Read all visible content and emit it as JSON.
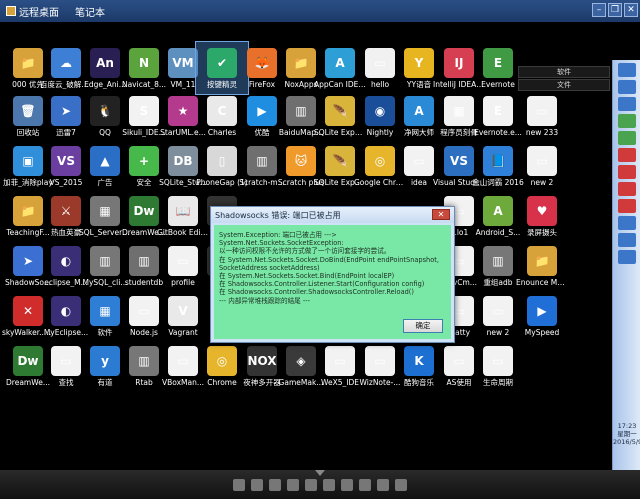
{
  "topbar": {
    "tabs": [
      "远程桌面",
      "笔记本"
    ]
  },
  "desktop": {
    "icons": [
      {
        "label": "000 优先",
        "glyph": "📁",
        "color": "#d8a23b"
      },
      {
        "label": "百度云_破解版_绿色",
        "glyph": "☁",
        "color": "#3c7fd4"
      },
      {
        "label": "Edge_Ani...",
        "glyph": "An",
        "color": "#2a1f52"
      },
      {
        "label": "Navicat_8...",
        "glyph": "N",
        "color": "#5ba33c"
      },
      {
        "label": "VM_11",
        "glyph": "VM",
        "color": "#5d8fbf"
      },
      {
        "label": "按键精灵",
        "glyph": "✔",
        "color": "#2ca86a"
      },
      {
        "label": "FireFox",
        "glyph": "🦊",
        "color": "#e8702a"
      },
      {
        "label": "NoxApps",
        "glyph": "📁",
        "color": "#d8a23b"
      },
      {
        "label": "AppCan IDE 个人版 v3...",
        "glyph": "A",
        "color": "#2d9fd6"
      },
      {
        "label": "hello",
        "glyph": "▭",
        "color": "#f1f1f1"
      },
      {
        "label": "YY语音",
        "glyph": "Y",
        "color": "#e7b51f"
      },
      {
        "label": "IntelliJ IDEA Communit...",
        "glyph": "IJ",
        "color": "#d63f52"
      },
      {
        "label": "Evernote",
        "glyph": "E",
        "color": "#3f9a43"
      },
      {
        "label": "回收站",
        "glyph": "🗑",
        "color": "#4b77ac"
      },
      {
        "label": "迅雷7",
        "glyph": "➤",
        "color": "#3a6fc7"
      },
      {
        "label": "QQ",
        "glyph": "🐧",
        "color": "#222"
      },
      {
        "label": "Sikuli_IDE...",
        "glyph": "S",
        "color": "#f2f2f2"
      },
      {
        "label": "StarUML.e...",
        "glyph": "★",
        "color": "#b33a8d"
      },
      {
        "label": "Charles",
        "glyph": "C",
        "color": "#e9e9e9"
      },
      {
        "label": "优酷",
        "glyph": "▶",
        "color": "#1f8de0"
      },
      {
        "label": "BaiduMap...",
        "glyph": "▥",
        "color": "#6f6f6f"
      },
      {
        "label": "SQLite Expert Per...",
        "glyph": "🪶",
        "color": "#d9b43a"
      },
      {
        "label": "Nightly",
        "glyph": "◉",
        "color": "#1b4e99"
      },
      {
        "label": "净网大师",
        "glyph": "A",
        "color": "#2a8ad6"
      },
      {
        "label": "程序员刻骨",
        "glyph": "▦",
        "color": "#f1f1f1"
      },
      {
        "label": "Evernote.e...",
        "glyph": "E",
        "color": "#f2f2f2"
      },
      {
        "label": "new 233",
        "glyph": "▭",
        "color": "#f2f2f2"
      },
      {
        "label": "加菲_消除play",
        "glyph": "▣",
        "color": "#2f8fdb"
      },
      {
        "label": "VS_2015",
        "glyph": "VS",
        "color": "#6b3fa0"
      },
      {
        "label": "广告",
        "glyph": "▲",
        "color": "#2a6fc5"
      },
      {
        "label": "安全",
        "glyph": "+",
        "color": "#47b84a"
      },
      {
        "label": "SQLite_Stu...",
        "glyph": "DB",
        "color": "#7f8e9d"
      },
      {
        "label": "PhoneGap (1)",
        "glyph": "▯",
        "color": "#d8d8d8"
      },
      {
        "label": "Scratch-m...",
        "glyph": "▥",
        "color": "#6f6f6f"
      },
      {
        "label": "Scratch plus",
        "glyph": "🐱",
        "color": "#f09a2b"
      },
      {
        "label": "SQLite Expert Per...",
        "glyph": "🪶",
        "color": "#d9b43a"
      },
      {
        "label": "Google Chrome C...",
        "glyph": "◎",
        "color": "#e6b52b"
      },
      {
        "label": "idea",
        "glyph": "▭",
        "color": "#f2f2f2"
      },
      {
        "label": "Visual Studio Co...",
        "glyph": "VS",
        "color": "#2c6fc0"
      },
      {
        "label": "金山词霸 2016",
        "glyph": "📘",
        "color": "#2f80d9"
      },
      {
        "label": "new 2",
        "glyph": "▭",
        "color": "#f2f2f2"
      },
      {
        "label": "TeachingF...",
        "glyph": "📁",
        "color": "#d8a23b"
      },
      {
        "label": "热血英豪",
        "glyph": "⚔",
        "color": "#9b3a2b"
      },
      {
        "label": "SQL_Server 2014_Studio",
        "glyph": "▦",
        "color": "#777"
      },
      {
        "label": "DreamWe...",
        "glyph": "Dw",
        "color": "#2e7a33"
      },
      {
        "label": "GitBook Editor",
        "glyph": "📖",
        "color": "#e9e9e9"
      },
      {
        "label": "Uni...",
        "glyph": "U",
        "color": "#333"
      },
      {
        "label": "...lo1",
        "glyph": "▭",
        "color": "#f2f2f2"
      },
      {
        "label": "Android_S...",
        "glyph": "A",
        "color": "#6ea93c"
      },
      {
        "label": "录屏摄头",
        "glyph": "♥",
        "color": "#d8324a"
      },
      {
        "label": "ShadowSo...",
        "glyph": "➤",
        "color": "#3b6fd1"
      },
      {
        "label": "eclipse_M...",
        "glyph": "◐",
        "color": "#3a2f77"
      },
      {
        "label": "MySQL_cli...",
        "glyph": "▥",
        "color": "#777"
      },
      {
        "label": "studentdb",
        "glyph": "▥",
        "color": "#6f6f6f"
      },
      {
        "label": "profile",
        "glyph": "▭",
        "color": "#f2f2f2"
      },
      {
        "label": "Min...",
        "glyph": "M",
        "color": "#333"
      },
      {
        "label": "...evCm...",
        "glyph": "▭",
        "color": "#f2f2f2"
      },
      {
        "label": "重组adb",
        "glyph": "▥",
        "color": "#777"
      },
      {
        "label": "Enounce MySpeed",
        "glyph": "📁",
        "color": "#d8a23b"
      },
      {
        "label": "skyWalker... 天行",
        "glyph": "✕",
        "color": "#d02c2c"
      },
      {
        "label": "MyEclipse...",
        "glyph": "◐",
        "color": "#3a2f77"
      },
      {
        "label": "软件",
        "glyph": "▦",
        "color": "#2f7ed6"
      },
      {
        "label": "Node.js",
        "glyph": "▭",
        "color": "#f2f2f2"
      },
      {
        "label": "Vagrant",
        "glyph": "V",
        "color": "#e9e9e9"
      },
      {
        "label": "_Wiz为知",
        "glyph": "▭",
        "color": "#f2f2f2"
      },
      {
        "label": "...atty",
        "glyph": "▭",
        "color": "#f2f2f2"
      },
      {
        "label": "new 2",
        "glyph": "▭",
        "color": "#f2f2f2"
      },
      {
        "label": "MySpeed",
        "glyph": "▶",
        "color": "#1f6fd6"
      },
      {
        "label": "DreamWe...",
        "glyph": "Dw",
        "color": "#2e7a33"
      },
      {
        "label": "查找",
        "glyph": "▭",
        "color": "#f2f2f2"
      },
      {
        "label": "有道",
        "glyph": "y",
        "color": "#2a7bd1"
      },
      {
        "label": "Rtab",
        "glyph": "▥",
        "color": "#777"
      },
      {
        "label": "VBoxMan...",
        "glyph": "▭",
        "color": "#f2f2f2"
      },
      {
        "label": "Chrome",
        "glyph": "◎",
        "color": "#e6b52b"
      },
      {
        "label": "夜神多开器",
        "glyph": "NOX",
        "color": "#333"
      },
      {
        "label": "GameMak...",
        "glyph": "◈",
        "color": "#3a3a3a"
      },
      {
        "label": "WeX5_IDE",
        "glyph": "▭",
        "color": "#f2f2f2"
      },
      {
        "label": "WizNote-...",
        "glyph": "▭",
        "color": "#f2f2f2"
      },
      {
        "label": "酷狗音乐",
        "glyph": "K",
        "color": "#1d6fd1"
      },
      {
        "label": "AS使用",
        "glyph": "▭",
        "color": "#f2f2f2"
      },
      {
        "label": "生命周期",
        "glyph": "▭",
        "color": "#f2f2f2"
      }
    ],
    "side_buttons": [
      "软件",
      "文件"
    ]
  },
  "dialog": {
    "title": "Shadowsocks 错误: 端口已被占用",
    "message": [
      "System.Exception: 端口已被占用 ---> System.Net.Sockets.SocketException:",
      "以一种访问权限不允许的方式做了一个访问套接字的尝试。",
      "    在 System.Net.Sockets.Socket.DoBind(EndPoint endPointSnapshot,",
      "SocketAddress socketAddress)",
      "    在 System.Net.Sockets.Socket.Bind(EndPoint localEP)",
      "    在 Shadowsocks.Controller.Listener.Start(Configuration config)",
      "    在 Shadowsocks.Controller.ShadowsocksController.Reload()",
      "    --- 内部异常堆栈跟踪的结尾 ---"
    ],
    "ok_label": "确定",
    "close_label": "✕"
  },
  "clock": {
    "time": "17:23",
    "weekday": "星期一",
    "date": "2016/5/9"
  }
}
